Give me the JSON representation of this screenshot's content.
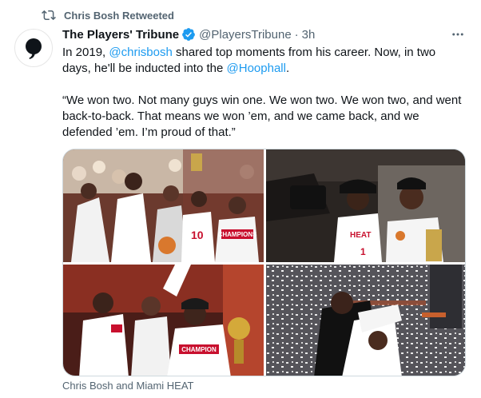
{
  "retweet_banner": {
    "text": "Chris Bosh Retweeted",
    "icon": "retweet-icon"
  },
  "tweet": {
    "author_name": "The Players' Tribune",
    "verified": true,
    "handle": "@PlayersTribune",
    "separator": "·",
    "time": "3h",
    "more_icon": "more-horizontal-icon",
    "text": {
      "p1_a": "In 2019, ",
      "mention_1": "@chrisbosh",
      "p1_b": " shared top moments from his career. Now, in two days, he'll be inducted into the ",
      "mention_2": "@Hoophall",
      "p1_c": ".",
      "p2": "“We won two. Not many guys win one. We won two. We won two, and went back-to-back. That means we won ’em, and we came back, and we defended ’em. I’m proud of that.”"
    },
    "media_caption": "Chris Bosh and Miami HEAT",
    "photos": [
      {
        "text": "10"
      },
      {
        "text": "CHAMPIONS"
      },
      {
        "text": "HEAT"
      },
      {
        "text": "1"
      },
      {
        "text": "CHAMPION"
      }
    ]
  },
  "colors": {
    "accent": "#1d9bf0",
    "secondary_text": "#536471",
    "primary_text": "#0f1419",
    "border": "#cfd9de"
  }
}
